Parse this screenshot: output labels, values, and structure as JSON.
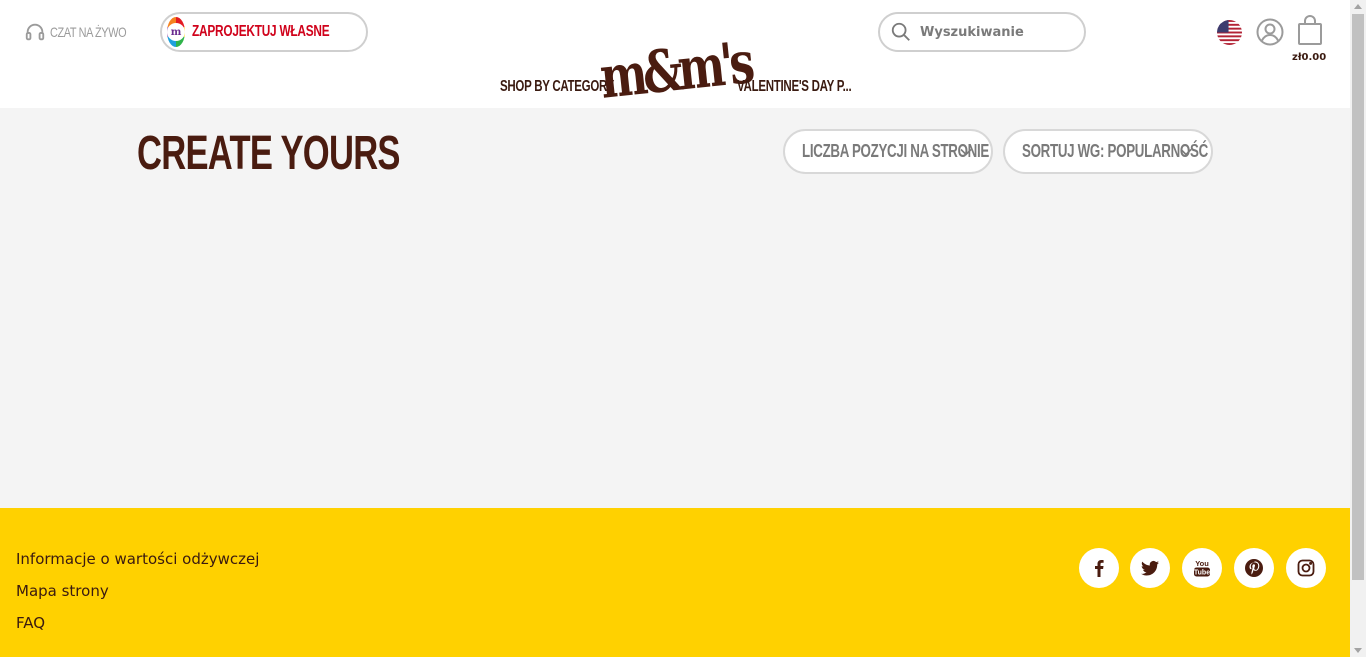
{
  "header": {
    "chat_label": "CZAT NA ŻYWO",
    "design_label": "ZAPROJEKTUJ WŁASNE",
    "design_badge_letter": "m",
    "logo_text": "m&m's",
    "nav": [
      "SHOP BY CATEGORY",
      "VALENTINE'S DAY P..."
    ],
    "search_placeholder": "Wyszukiwanie",
    "cart_total": "zł0.00"
  },
  "main": {
    "title": "CREATE YOURS",
    "per_page_label": "LICZBA POZYCJI NA STRONIE",
    "sort_label": "SORTUJ WG: POPULARNOŚĆ"
  },
  "footer": {
    "links": [
      "Informacje o wartości odżywczej",
      "Mapa strony",
      "FAQ"
    ],
    "social": [
      "facebook-icon",
      "twitter-icon",
      "youtube-icon",
      "pinterest-icon",
      "instagram-icon"
    ],
    "youtube_text": [
      "You",
      "Tube"
    ]
  },
  "colors": {
    "brand_brown": "#4a1c10",
    "accent_red": "#d0021b",
    "footer_yellow": "#ffd100",
    "main_bg": "#f4f4f4"
  }
}
